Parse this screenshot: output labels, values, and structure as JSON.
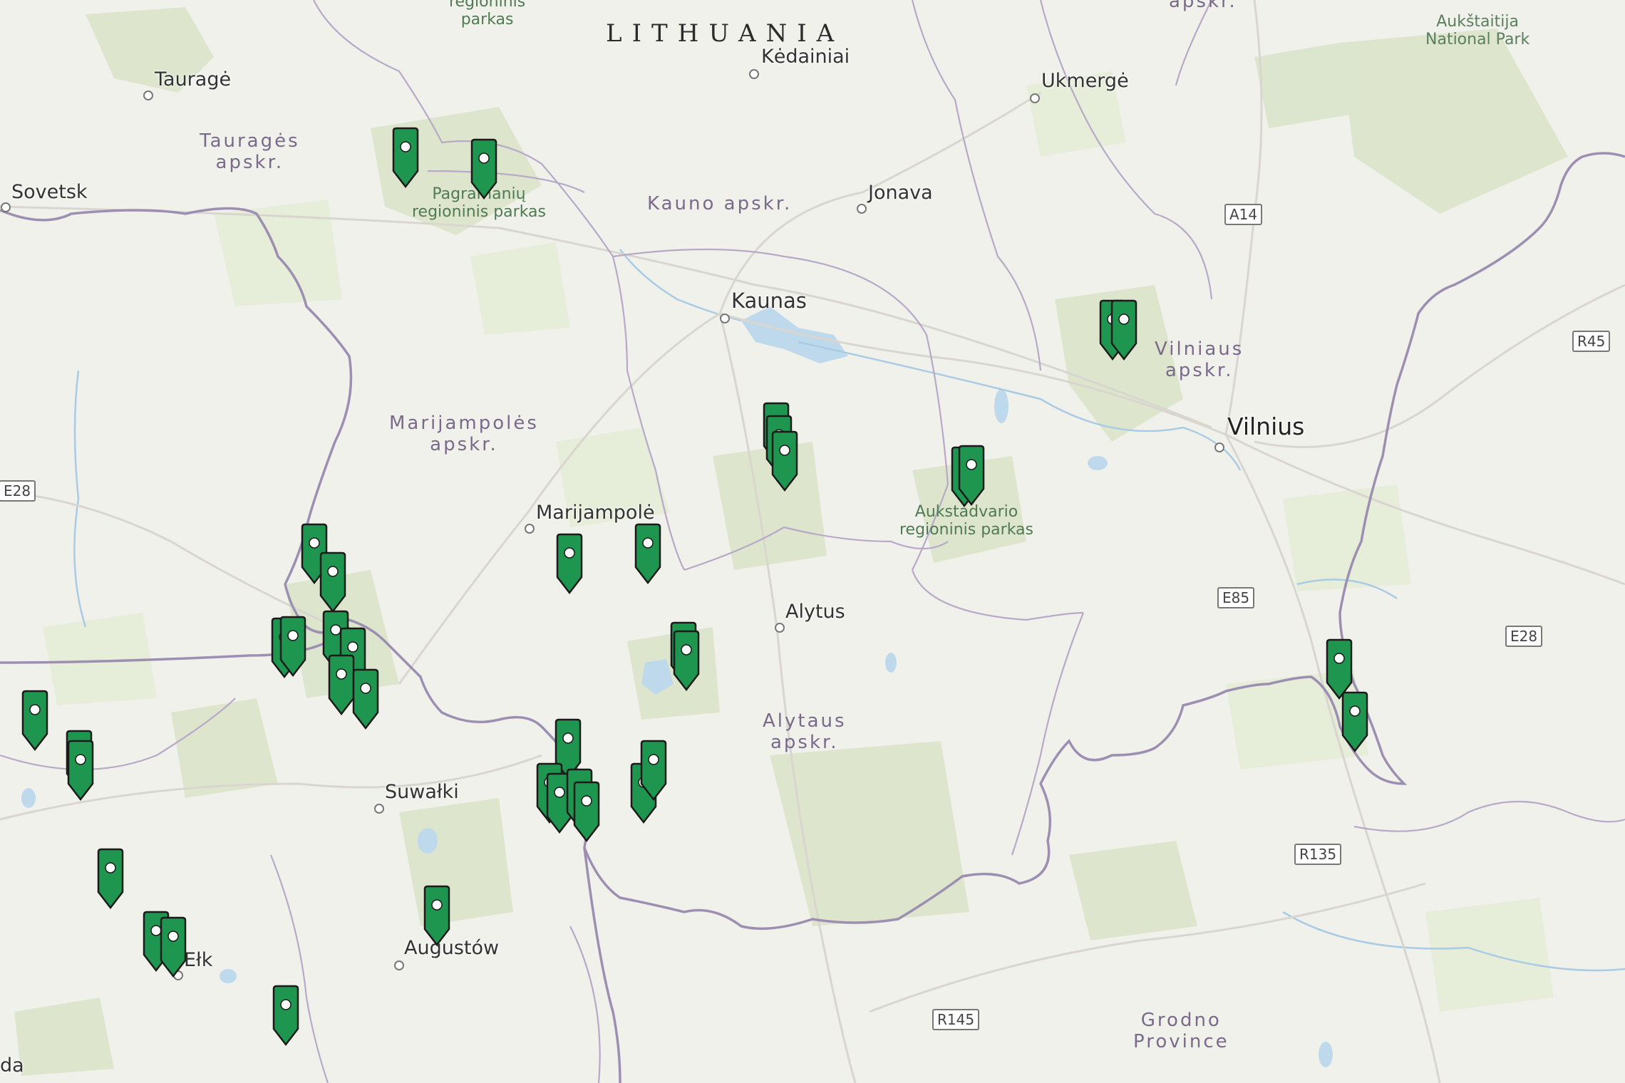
{
  "map": {
    "country_label": "LITHUANIA",
    "cities": [
      {
        "name": "Kėdainiai",
        "id": "kedainiai"
      },
      {
        "name": "Tauragė",
        "id": "taurage"
      },
      {
        "name": "Ukmergė",
        "id": "ukmerge"
      },
      {
        "name": "Sovetsk",
        "id": "sovetsk"
      },
      {
        "name": "Jonava",
        "id": "jonava"
      },
      {
        "name": "Kaunas",
        "id": "kaunas"
      },
      {
        "name": "Vilnius",
        "id": "vilnius"
      },
      {
        "name": "Marijampolė",
        "id": "marijampole"
      },
      {
        "name": "Alytus",
        "id": "alytus"
      },
      {
        "name": "Suwałki",
        "id": "suwalki"
      },
      {
        "name": "Augustów",
        "id": "augustow"
      },
      {
        "name": "Ełk",
        "id": "elk"
      },
      {
        "name": "da",
        "id": "da"
      }
    ],
    "regions": {
      "taurage": "Tauragės\napskr.",
      "kauno": "Kauno apskr.",
      "marijampoles": "Marijampolės\napskr.",
      "vilniaus": "Vilniaus\napskr.",
      "alytaus": "Alytaus\napskr.",
      "grodno": "Grodno\nProvince"
    },
    "parks": {
      "top": "regioninis\nparkas",
      "pagramantis": "Pagramanių\nregioninis parkas",
      "aukstadvario": "Aukstadvario\nregioninis parkas",
      "aukstaitija": "Aukštaitija\nNational Park",
      "top_right": "apskr."
    },
    "roads": [
      "A14",
      "R45",
      "E28",
      "E85",
      "E28",
      "R135",
      "R145"
    ],
    "marker_color": "#1e9650"
  }
}
